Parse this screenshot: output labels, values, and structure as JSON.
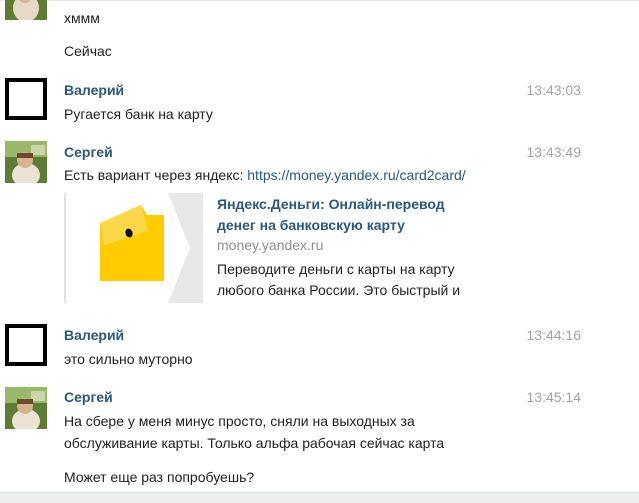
{
  "messages": {
    "top_partial": {
      "line1": "хммм",
      "line2": "Сейчас"
    },
    "m1": {
      "author": "Валерий",
      "time": "13:43:03",
      "text": "Ругается банк на карту"
    },
    "m2": {
      "author": "Сергей",
      "time": "13:43:49",
      "text_prefix": "Есть вариант через яндекс: ",
      "link": "https://money.yandex.ru/card2card/",
      "preview": {
        "title_line1": "Яндекс.Деньги: Онлайн-перевод",
        "title_line2": "денег на банковскую карту",
        "domain": "money.yandex.ru",
        "desc_line1": "Переводите деньги с карты на карту",
        "desc_line2": "любого банка России. Это быстрый и"
      }
    },
    "m3": {
      "author": "Валерий",
      "time": "13:44:16",
      "text": "это сильно муторно"
    },
    "m4": {
      "author": "Сергей",
      "time": "13:45:14",
      "text_line1": "На сбере у меня минус просто, сняли на выходных за",
      "text_line2": "обслуживание карты. Только альфа рабочая сейчас карта",
      "text_line3": "Может еще раз попробуешь?"
    }
  },
  "colors": {
    "author_name": "#2b587a",
    "timestamp": "#a0a4a8",
    "link": "#2b587a",
    "yandex_yellow": "#ffcc00"
  },
  "icons": {
    "preview_thumb": "yandex-money-wallet-icon"
  }
}
